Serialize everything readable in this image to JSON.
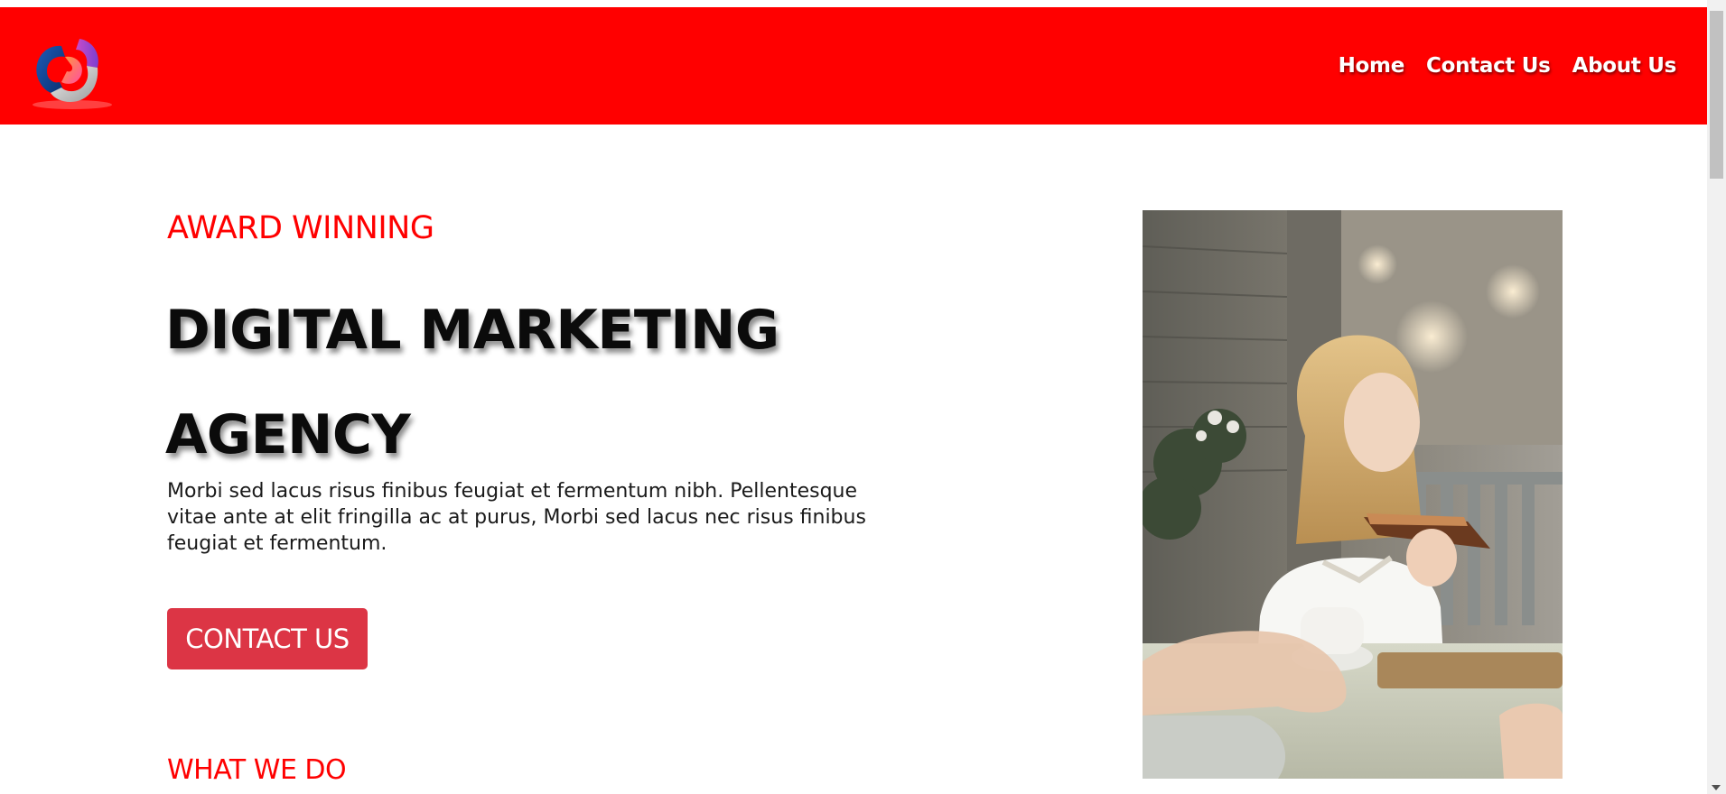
{
  "nav": {
    "links": [
      "Home",
      "Contact Us",
      "About Us"
    ]
  },
  "hero": {
    "eyebrow": "AWARD WINNING",
    "title_line1": "DIGITAL MARKETING",
    "title_line2": "AGENCY",
    "body": "Morbi sed lacus risus finibus feugiat et fermentum nibh. Pellentesque vitae ante at elit fringilla ac at purus, Morbi sed lacus nec risus finibus feugiat et fermentum.",
    "button_label": "CONTACT US"
  },
  "section": {
    "heading": "WHAT WE DO"
  },
  "colors": {
    "brand_red": "#ff0000",
    "button_red": "#dc3545"
  },
  "icons": {
    "logo": "brand-logo",
    "scroll_down": "scroll-down-arrow"
  }
}
